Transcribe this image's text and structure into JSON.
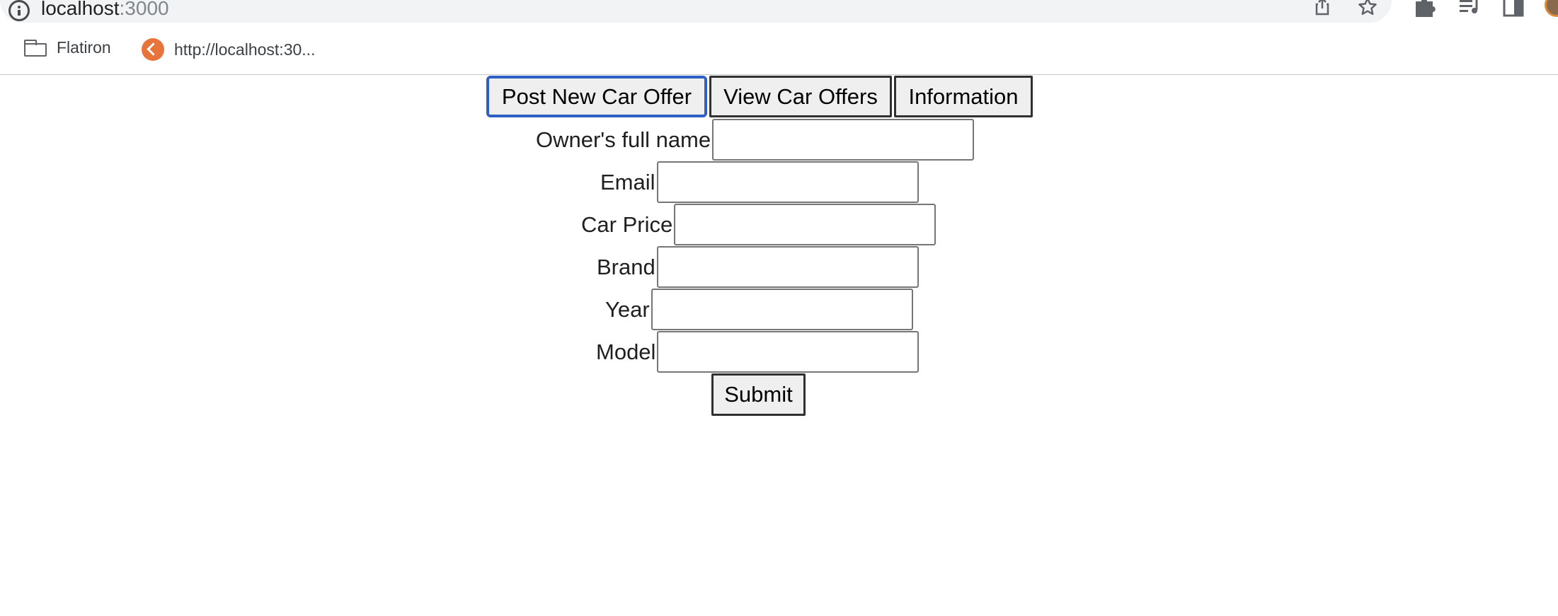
{
  "browser": {
    "url_host": "localhost",
    "url_port": ":3000",
    "bookmarks": [
      {
        "label": "Flatiron",
        "icon": "folder-icon"
      },
      {
        "label": "http://localhost:30...",
        "icon": "favicon-icon"
      }
    ]
  },
  "nav": {
    "post_label": "Post New Car Offer",
    "view_label": "View Car Offers",
    "info_label": "Information"
  },
  "form": {
    "owner_label": "Owner's full name",
    "email_label": "Email",
    "price_label": "Car Price",
    "brand_label": "Brand",
    "year_label": "Year",
    "model_label": "Model",
    "owner_value": "",
    "email_value": "",
    "price_value": "",
    "brand_value": "",
    "year_value": "",
    "model_value": "",
    "submit_label": "Submit"
  },
  "colors": {
    "focus_ring": "#2e5fc4",
    "favicon": "#e8743b",
    "button_bg": "#efefef"
  }
}
